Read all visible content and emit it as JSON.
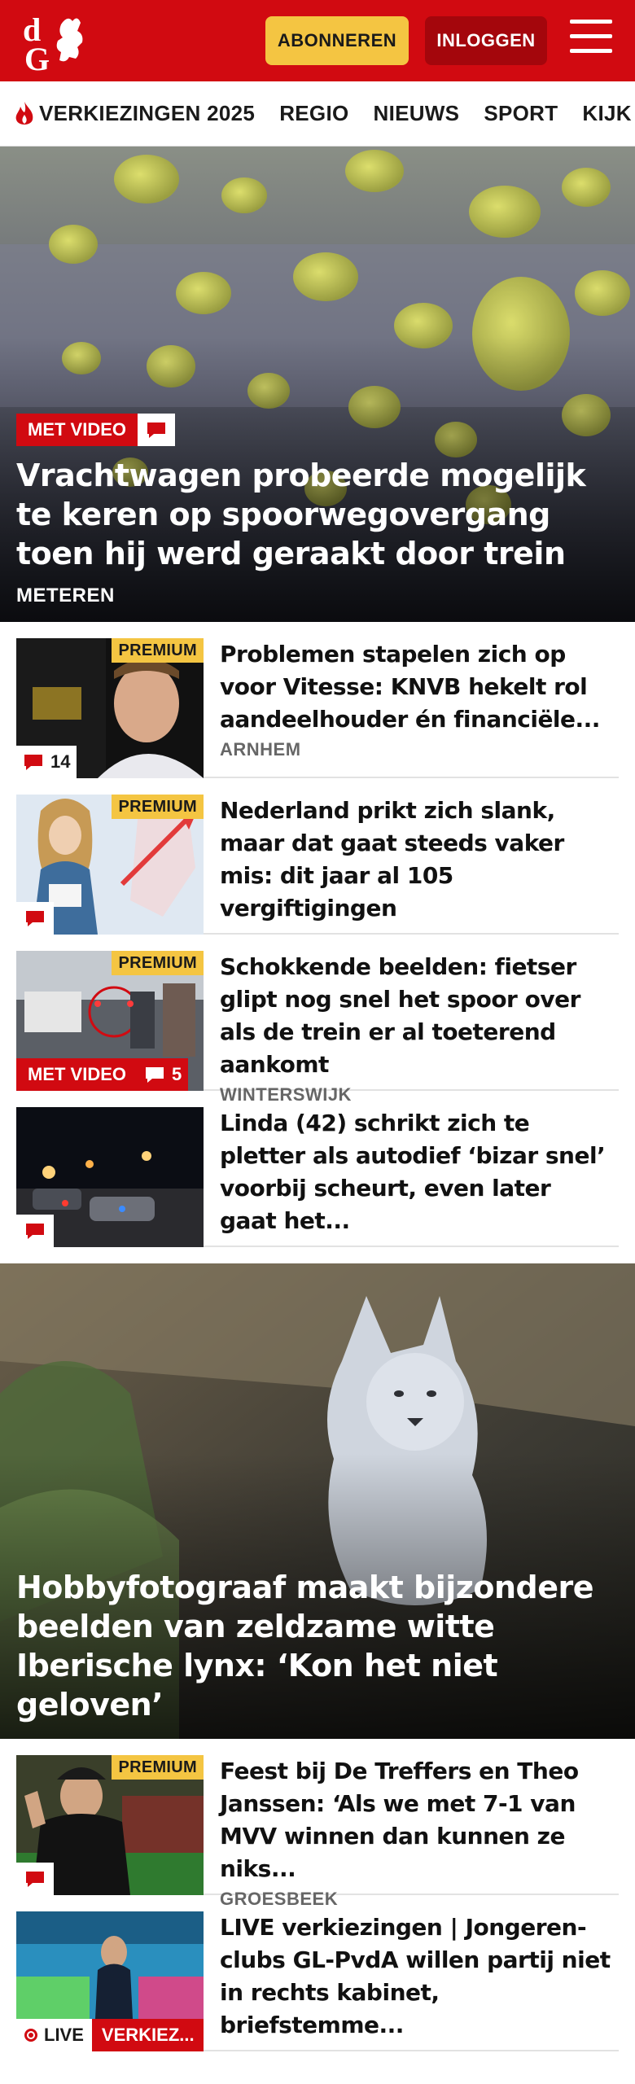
{
  "header": {
    "subscribe_label": "ABONNEREN",
    "login_label": "INLOGGEN",
    "brand_color": "#d10a11"
  },
  "nav": {
    "items": [
      "VERKIEZINGEN 2025",
      "REGIO",
      "NIEUWS",
      "SPORT",
      "KIJK"
    ]
  },
  "hero": {
    "badge": "MET VIDEO",
    "title": "Vrachtwagen probeerde mogelijk te keren op spoorwegovergang toen hij werd geraakt door trein",
    "location": "METEREN"
  },
  "articles": [
    {
      "premium": "PREMIUM",
      "comments": "14",
      "title": "Problemen stapelen zich op voor Vitesse: KNVB hekelt rol aandeelhouder én financiële...",
      "location": "ARNHEM"
    },
    {
      "premium": "PREMIUM",
      "title": "Nederland prikt zich slank, maar dat gaat steeds vaker mis: dit jaar al 105 vergiftigingen"
    },
    {
      "premium": "PREMIUM",
      "badge": "MET VIDEO",
      "comments": "5",
      "title": "Schokkende beelden: fietser glipt nog snel het spoor over als de trein er al toeterend aankomt",
      "location": "WINTERSWIJK"
    },
    {
      "title": "Linda (42) schrikt zich te pletter als autodief ‘bizar snel’ voorbij scheurt, even later gaat het..."
    }
  ],
  "hero2": {
    "title": "Hobbyfotograaf maakt bijzondere beelden van zeldzame witte Iberische lynx: ‘Kon het niet geloven’"
  },
  "articles2": [
    {
      "premium": "PREMIUM",
      "title": "Feest bij De Treffers en Theo Janssen: ‘Als we met 7-1 van MVV winnen dan kunnen ze niks...",
      "location": "GROESBEEK"
    },
    {
      "live": "LIVE",
      "tag": "VERKIEZ...",
      "title": "LIVE verkiezingen | Jongeren­clubs GL-PvdA willen partij niet in rechts kabinet, briefstemme..."
    }
  ]
}
